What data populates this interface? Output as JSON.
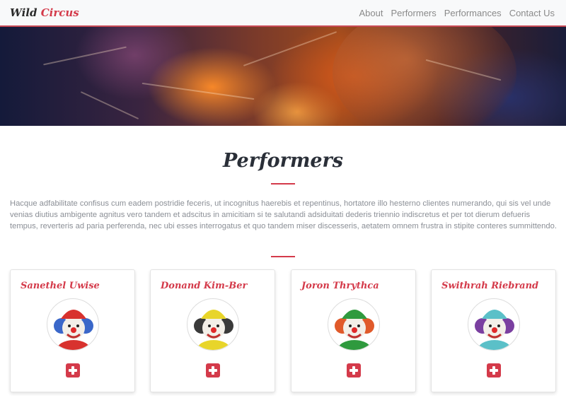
{
  "navbar": {
    "brand_main": "Wild",
    "brand_accent": "Circus",
    "links": [
      {
        "label": "About"
      },
      {
        "label": "Performers"
      },
      {
        "label": "Performances"
      },
      {
        "label": "Contact Us"
      }
    ]
  },
  "section": {
    "title": "Performers",
    "intro": "Hacque adfabilitate confisus cum eadem postridie feceris, ut incognitus haerebis et repentinus, hortatore illo hesterno clientes numerando, qui sis vel unde venias diutius ambigente agnitus vero tandem et adscitus in amicitiam si te salutandi adsiduitati dederis triennio indiscretus et per tot dierum defueris tempus, reverteris ad paria perferenda, nec ubi esses interrogatus et quo tandem miser discesseris, aetatem omnem frustra in stipite conteres summittendo."
  },
  "performers": [
    {
      "name": "Sanethel Uwise",
      "avatar_icon": "clown-avatar-icon",
      "hat_color": "#d8322e",
      "hair_color": "#3a67c9",
      "action_icon": "plus-icon"
    },
    {
      "name": "Donand Kim-Ber",
      "avatar_icon": "clown-avatar-icon",
      "hat_color": "#e8d52a",
      "hair_color": "#3a3a3a",
      "action_icon": "plus-icon"
    },
    {
      "name": "Joron Thrythca",
      "avatar_icon": "clown-avatar-icon",
      "hat_color": "#2f9a3e",
      "hair_color": "#e05a2a",
      "action_icon": "plus-icon"
    },
    {
      "name": "Swithrah Riebrand",
      "avatar_icon": "clown-avatar-icon",
      "hat_color": "#5bc0c8",
      "hair_color": "#7a3fa0",
      "action_icon": "plus-icon"
    }
  ],
  "colors": {
    "accent": "#d43a4a",
    "text_muted": "#8b8f96",
    "heading": "#2a2f38"
  }
}
